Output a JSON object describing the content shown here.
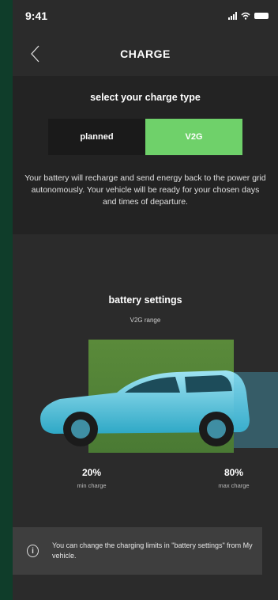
{
  "status_bar": {
    "time": "9:41",
    "signal_icon": "signal-icon",
    "wifi_icon": "wifi-icon",
    "battery_icon": "battery-icon"
  },
  "nav": {
    "title": "CHARGE",
    "back_icon": "chevron-left-icon"
  },
  "charge_type": {
    "heading": "select your charge type",
    "options": [
      {
        "label": "planned",
        "selected": false
      },
      {
        "label": "V2G",
        "selected": true
      }
    ],
    "description": "Your battery will recharge and send energy back to the power grid autonomously. Your vehicle will be ready for your chosen days and times of departure."
  },
  "battery_settings": {
    "heading": "battery settings",
    "range_label": "V2G range",
    "min": {
      "value": "20%",
      "label": "min charge"
    },
    "max": {
      "value": "80%",
      "label": "max charge"
    }
  },
  "info_box": {
    "icon": "info-icon",
    "text": "You can change the charging limits in \"battery settings\" from My vehicle."
  },
  "colors": {
    "accent": "#6fd16a",
    "background": "#2b2b2b",
    "v2g_range": "#5a8a3a",
    "car_overlay": "#33b8d6"
  }
}
